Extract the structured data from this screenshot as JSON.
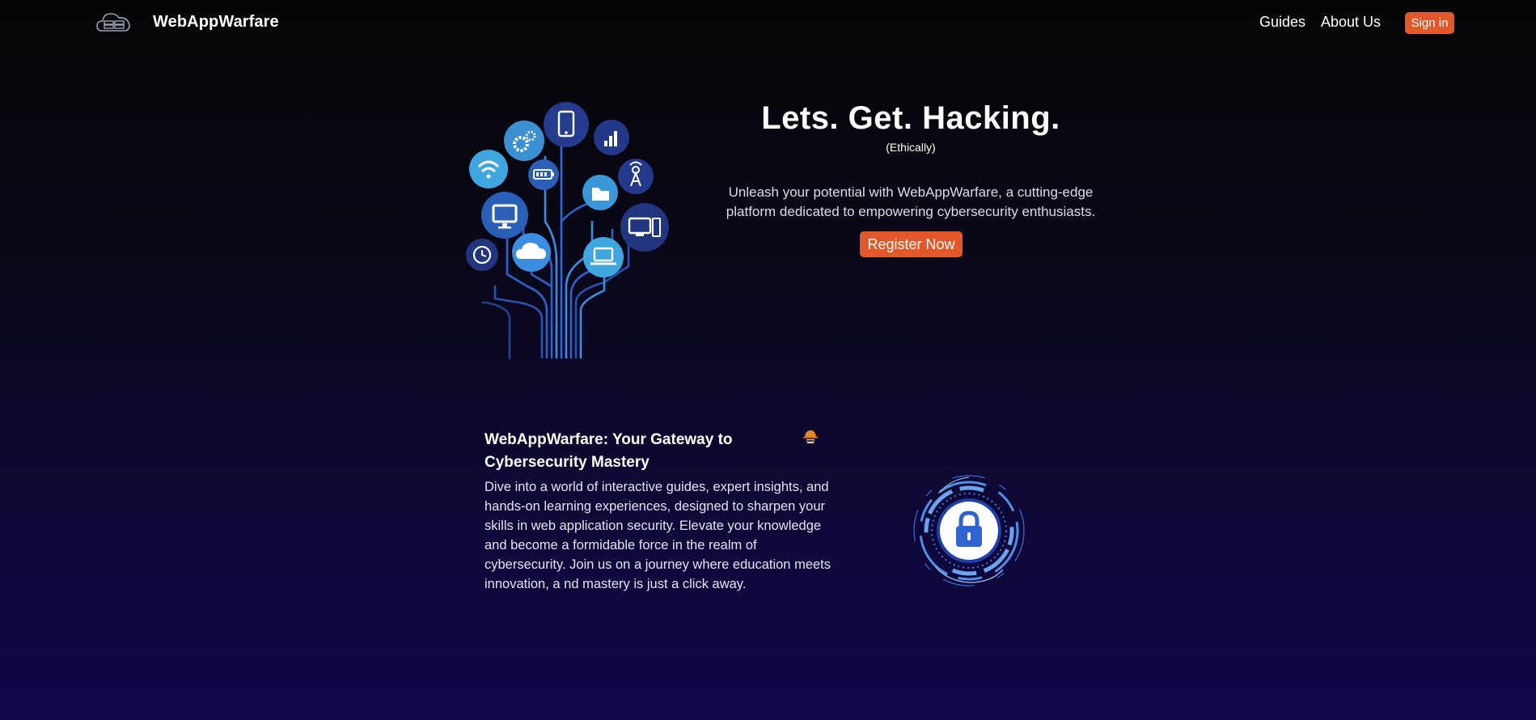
{
  "nav": {
    "brand": "WebAppWarfare",
    "links": [
      {
        "label": "Guides",
        "icon": null
      },
      {
        "label": "About Us",
        "icon": null
      }
    ],
    "signin_label": "Sign in",
    "logo_icon": "cloud-server-icon"
  },
  "hero": {
    "title": "Lets. Get. Hacking.",
    "subtitle": "(Ethically)",
    "description": "Unleash your potential with WebAppWarfare, a cutting-edge platform dedicated to empowering cybersecurity enthusiasts.",
    "cta_label": "Register Now",
    "illustration": "technology-tree-illustration"
  },
  "feature": {
    "title": "WebAppWarfare: Your Gateway to Cybersecurity Mastery",
    "body": "Dive into a world of interactive guides, expert insights, and hands-on learning experiences, designed to sharpen your skills in web application security. Elevate your knowledge and become a formidable force in the realm of cybersecurity. Join us on a journey where education meets innovation, a nd mastery is just a click away.",
    "badge_icon": "hacker-hat-icon",
    "illustration": "security-lock-illustration"
  },
  "colors": {
    "accent": "#e2582a",
    "background_top": "#050505",
    "background_bottom": "#120648"
  }
}
